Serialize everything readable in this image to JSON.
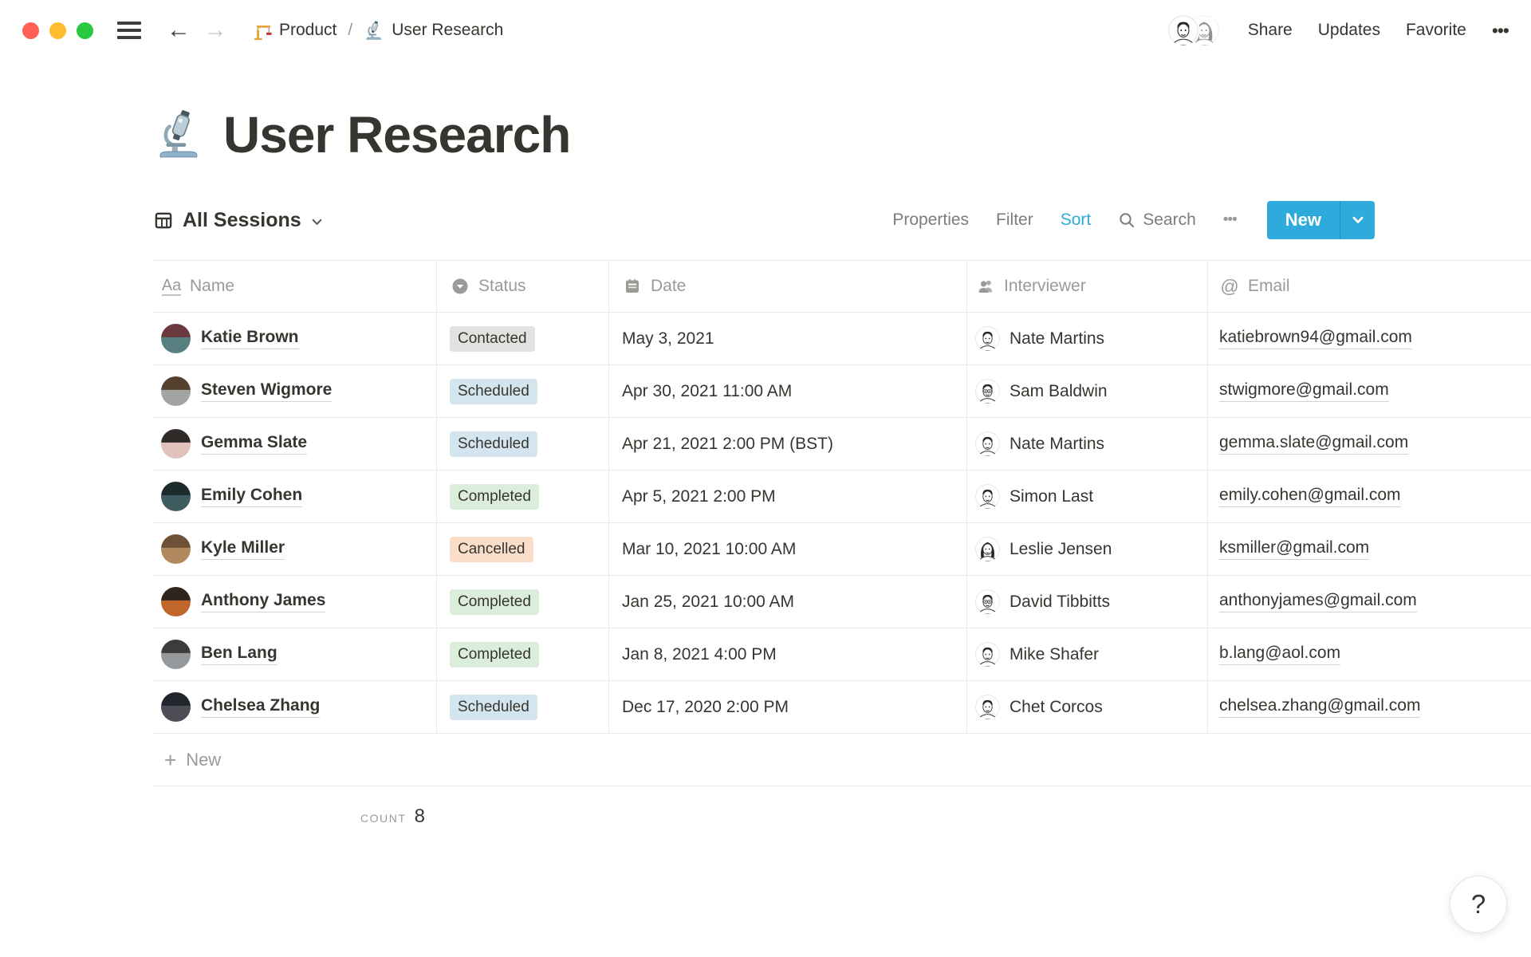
{
  "window_bar": {
    "traffic_lights": {
      "close": "#FF5F57",
      "minimize": "#FEBC2E",
      "zoom": "#28C840"
    },
    "breadcrumb": {
      "items": [
        {
          "icon": "crane-icon",
          "label": "Product"
        },
        {
          "icon": "microscope-icon",
          "label": "User Research"
        }
      ],
      "separator": "/"
    },
    "avatars": [
      "sketch-man",
      "sketch-woman-glasses"
    ],
    "actions": {
      "share": "Share",
      "updates": "Updates",
      "favorite": "Favorite",
      "more": "•••"
    }
  },
  "page": {
    "icon": "microscope-icon",
    "title": "User Research"
  },
  "toolbar": {
    "view": {
      "icon": "table-view-icon",
      "label": "All Sessions"
    },
    "properties_label": "Properties",
    "filter_label": "Filter",
    "sort_label": "Sort",
    "search_label": "Search",
    "more": "•••",
    "new_label": "New"
  },
  "colors": {
    "accent": "#2EAADC",
    "border": "#E9E9E7",
    "muted_text": "#9B9A97",
    "dark_text": "#37352F"
  },
  "badge_colors": {
    "gray": "#E3E2E0",
    "blue": "#D3E5EF",
    "green": "#DBEDDB",
    "peach": "#FADEC9"
  },
  "table": {
    "columns": [
      {
        "key": "name",
        "label": "Name",
        "icon": "title-icon"
      },
      {
        "key": "status",
        "label": "Status",
        "icon": "select-icon"
      },
      {
        "key": "date",
        "label": "Date",
        "icon": "calendar-icon"
      },
      {
        "key": "interviewer",
        "label": "Interviewer",
        "icon": "people-icon"
      },
      {
        "key": "email",
        "label": "Email",
        "icon": "at-icon"
      }
    ],
    "rows": [
      {
        "name": "Katie Brown",
        "status": "Contacted",
        "status_color": "gray",
        "date": "May 3, 2021",
        "interviewer": "Nate Martins",
        "email": "katiebrown94@gmail.com",
        "avatar_colors": [
          "#6b3a3e",
          "#577f80"
        ],
        "interviewer_avatar": "sketch-man"
      },
      {
        "name": "Steven Wigmore",
        "status": "Scheduled",
        "status_color": "blue",
        "date": "Apr 30, 2021 11:00 AM",
        "interviewer": "Sam Baldwin",
        "email": "stwigmore@gmail.com",
        "avatar_colors": [
          "#55412f",
          "#a3a3a1"
        ],
        "interviewer_avatar": "sketch-glasses"
      },
      {
        "name": "Gemma Slate",
        "status": "Scheduled",
        "status_color": "blue",
        "date": "Apr 21, 2021 2:00 PM (BST)",
        "interviewer": "Nate Martins",
        "email": "gemma.slate@gmail.com",
        "avatar_colors": [
          "#2f2a28",
          "#e0c4bc"
        ],
        "interviewer_avatar": "sketch-man"
      },
      {
        "name": "Emily Cohen",
        "status": "Completed",
        "status_color": "green",
        "date": "Apr 5, 2021 2:00 PM",
        "interviewer": "Simon Last",
        "email": "emily.cohen@gmail.com",
        "avatar_colors": [
          "#1d2b2d",
          "#3f5c60"
        ],
        "interviewer_avatar": "sketch-man"
      },
      {
        "name": "Kyle Miller",
        "status": "Cancelled",
        "status_color": "peach",
        "date": "Mar 10, 2021 10:00 AM",
        "interviewer": "Leslie Jensen",
        "email": "ksmiller@gmail.com",
        "avatar_colors": [
          "#6e5137",
          "#b08a5e"
        ],
        "interviewer_avatar": "sketch-woman"
      },
      {
        "name": "Anthony James",
        "status": "Completed",
        "status_color": "green",
        "date": "Jan 25, 2021 10:00 AM",
        "interviewer": "David Tibbitts",
        "email": "anthonyjames@gmail.com",
        "avatar_colors": [
          "#30241f",
          "#c0662b"
        ],
        "interviewer_avatar": "sketch-glasses"
      },
      {
        "name": "Ben Lang",
        "status": "Completed",
        "status_color": "green",
        "date": "Jan 8, 2021 4:00 PM",
        "interviewer": "Mike Shafer",
        "email": "b.lang@aol.com",
        "avatar_colors": [
          "#3c3c3c",
          "#95999b"
        ],
        "interviewer_avatar": "sketch-man"
      },
      {
        "name": "Chelsea Zhang",
        "status": "Scheduled",
        "status_color": "blue",
        "date": "Dec 17, 2020 2:00 PM",
        "interviewer": "Chet Corcos",
        "email": "chelsea.zhang@gmail.com",
        "avatar_colors": [
          "#23252c",
          "#4e4e56"
        ],
        "interviewer_avatar": "sketch-man"
      }
    ],
    "new_row_label": "New",
    "count": {
      "label": "COUNT",
      "value": "8"
    }
  },
  "help_button": {
    "label": "?"
  }
}
